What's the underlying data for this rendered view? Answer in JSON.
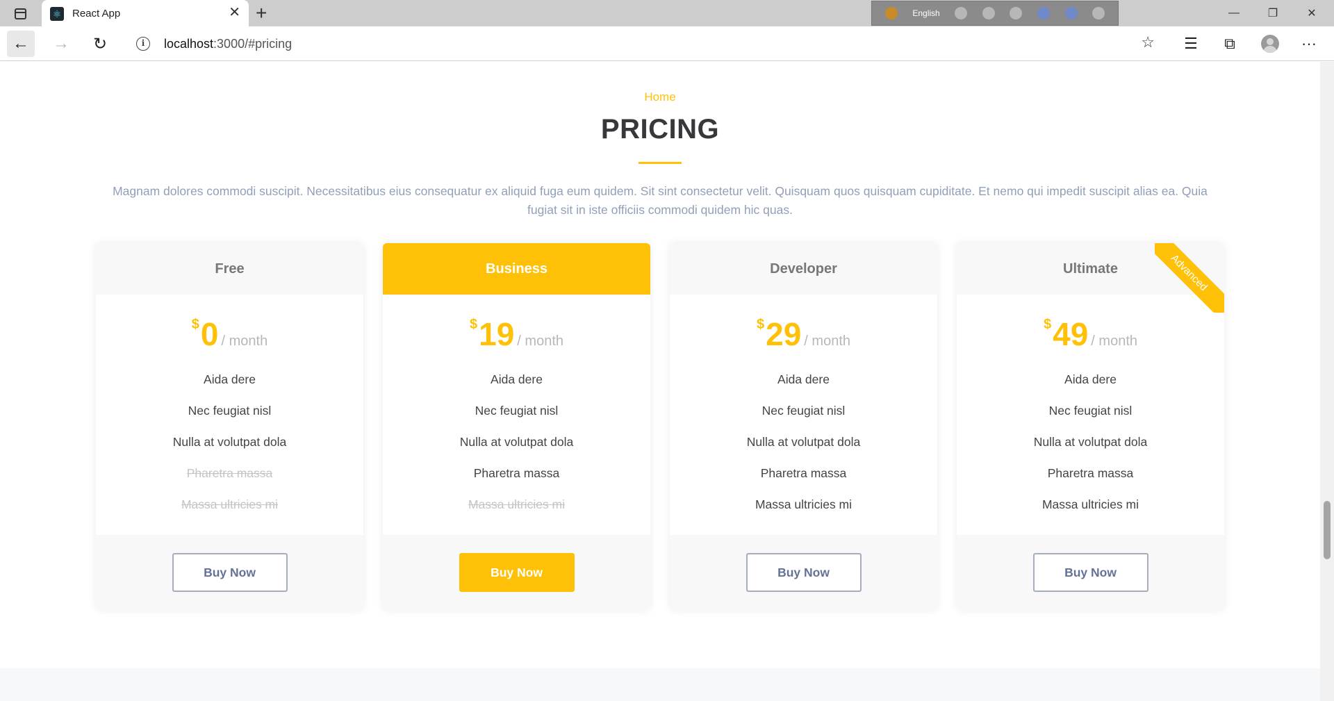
{
  "browser": {
    "tab_title": "React App",
    "tab_favicon": "react-logo",
    "new_tab_symbol": "+",
    "close_symbol": "✕",
    "url_host": "localhost",
    "url_path": ":3000/#pricing",
    "ime": {
      "language": "English"
    },
    "window_controls": {
      "minimize": "—",
      "restore": "❐",
      "close": "✕"
    },
    "nav": {
      "back": "←",
      "forward": "→",
      "reload": "↻"
    },
    "toolbar": {
      "favorite": "☆",
      "favorites_list": "☰",
      "collections": "⧉",
      "more": "···"
    }
  },
  "page": {
    "breadcrumb": "Home",
    "title": "PRICING",
    "intro": "Magnam dolores commodi suscipit. Necessitatibus eius consequatur ex aliquid fuga eum quidem. Sit sint consectetur velit. Quisquam quos quisquam cupiditate. Et nemo qui impedit suscipit alias ea. Quia fugiat sit in iste officiis commodi quidem hic quas.",
    "accent_color": "#ffc107",
    "plans": [
      {
        "name": "Free",
        "currency": "$",
        "amount": "0",
        "period": "/ month",
        "featured": false,
        "ribbon": "",
        "features": [
          "Aida dere",
          "Nec feugiat nisl",
          "Nulla at volutpat dola",
          "Pharetra massa",
          "Massa ultricies mi"
        ],
        "available": [
          true,
          true,
          true,
          false,
          false
        ],
        "button": "Buy Now"
      },
      {
        "name": "Business",
        "currency": "$",
        "amount": "19",
        "period": "/ month",
        "featured": true,
        "ribbon": "",
        "features": [
          "Aida dere",
          "Nec feugiat nisl",
          "Nulla at volutpat dola",
          "Pharetra massa",
          "Massa ultricies mi"
        ],
        "available": [
          true,
          true,
          true,
          true,
          false
        ],
        "button": "Buy Now"
      },
      {
        "name": "Developer",
        "currency": "$",
        "amount": "29",
        "period": "/ month",
        "featured": false,
        "ribbon": "",
        "features": [
          "Aida dere",
          "Nec feugiat nisl",
          "Nulla at volutpat dola",
          "Pharetra massa",
          "Massa ultricies mi"
        ],
        "available": [
          true,
          true,
          true,
          true,
          true
        ],
        "button": "Buy Now"
      },
      {
        "name": "Ultimate",
        "currency": "$",
        "amount": "49",
        "period": "/ month",
        "featured": false,
        "ribbon": "Advanced",
        "features": [
          "Aida dere",
          "Nec feugiat nisl",
          "Nulla at volutpat dola",
          "Pharetra massa",
          "Massa ultricies mi"
        ],
        "available": [
          true,
          true,
          true,
          true,
          true
        ],
        "button": "Buy Now"
      }
    ]
  }
}
